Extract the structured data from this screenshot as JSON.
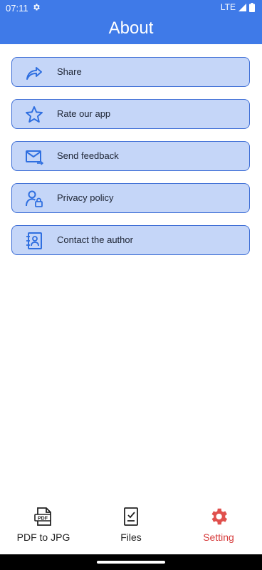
{
  "status": {
    "time": "07:11",
    "network": "LTE"
  },
  "header": {
    "title": "About",
    "color": "#3f7ae8"
  },
  "menu": [
    {
      "label": "Share",
      "icon": "share-icon"
    },
    {
      "label": "Rate our app",
      "icon": "star-icon"
    },
    {
      "label": "Send feedback",
      "icon": "mail-icon"
    },
    {
      "label": "Privacy policy",
      "icon": "user-lock-icon"
    },
    {
      "label": "Contact the author",
      "icon": "contact-book-icon"
    }
  ],
  "nav": [
    {
      "label": "PDF to JPG",
      "icon": "pdf-icon",
      "active": false
    },
    {
      "label": "Files",
      "icon": "checklist-file-icon",
      "active": false
    },
    {
      "label": "Setting",
      "icon": "gear-icon",
      "active": true
    }
  ],
  "colors": {
    "accent": "#3f7ae8",
    "item_bg": "#c5d6f8",
    "item_border": "#3f6fd6",
    "active_tab": "#d63a3a"
  }
}
